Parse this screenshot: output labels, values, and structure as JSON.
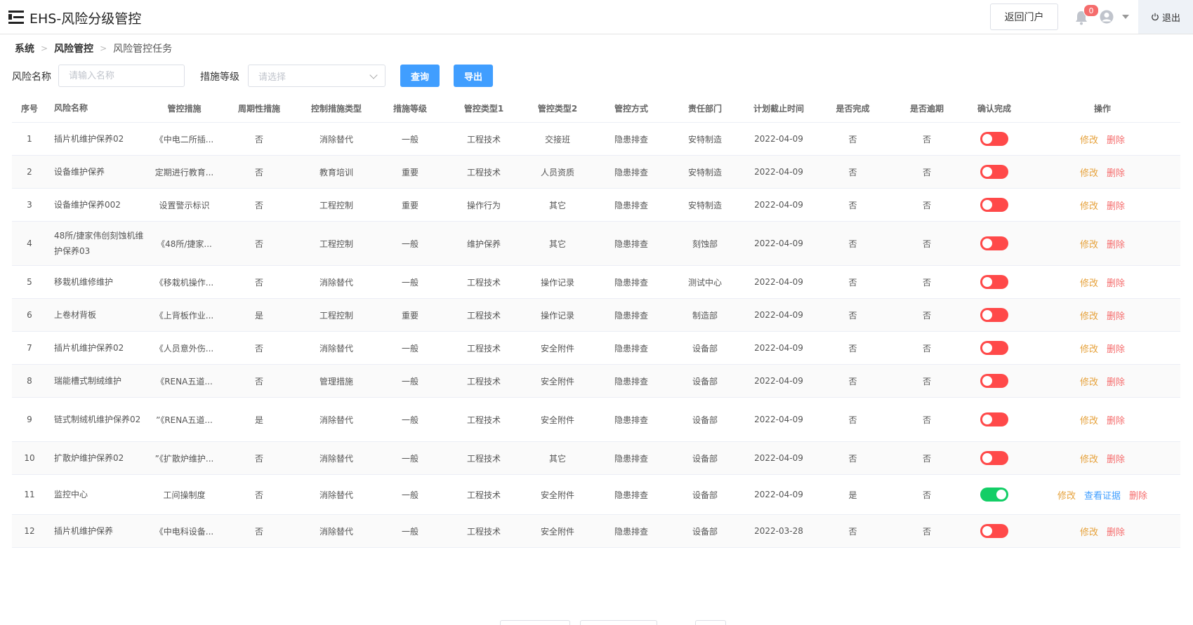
{
  "header": {
    "title": "EHS-风险分级管控",
    "portal_button": "返回门户",
    "notification_count": "0",
    "logout_label": "退出"
  },
  "breadcrumb": [
    "系统",
    "风险管控",
    "风险管控任务"
  ],
  "filters": {
    "risk_name_label": "风险名称",
    "risk_name_placeholder": "请输入名称",
    "level_label": "措施等级",
    "level_placeholder": "请选择",
    "query_button": "查询",
    "export_button": "导出"
  },
  "table": {
    "columns": [
      "序号",
      "风险名称",
      "管控措施",
      "周期性措施",
      "控制措施类型",
      "措施等级",
      "管控类型1",
      "管控类型2",
      "管控方式",
      "责任部门",
      "计划截止时间",
      "是否完成",
      "是否逾期",
      "确认完成",
      "操作"
    ],
    "actions": {
      "edit": "修改",
      "view": "查看证据",
      "delete": "删除"
    },
    "rows": [
      {
        "no": "1",
        "name": "插片机维护保养02",
        "measure": "《中电二所插...",
        "periodic": "否",
        "ctype": "消除替代",
        "level": "一般",
        "t1": "工程技术",
        "t2": "交接班",
        "method": "隐患排查",
        "dept": "安特制造",
        "deadline": "2022-04-09",
        "done": "否",
        "overdue": "否",
        "confirmed": false
      },
      {
        "no": "2",
        "name": "设备维护保养",
        "measure": "定期进行教育...",
        "periodic": "否",
        "ctype": "教育培训",
        "level": "重要",
        "t1": "工程技术",
        "t2": "人员资质",
        "method": "隐患排查",
        "dept": "安特制造",
        "deadline": "2022-04-09",
        "done": "否",
        "overdue": "否",
        "confirmed": false
      },
      {
        "no": "3",
        "name": "设备维护保养002",
        "measure": "设置警示标识",
        "periodic": "否",
        "ctype": "工程控制",
        "level": "重要",
        "t1": "操作行为",
        "t2": "其它",
        "method": "隐患排查",
        "dept": "安特制造",
        "deadline": "2022-04-09",
        "done": "否",
        "overdue": "否",
        "confirmed": false
      },
      {
        "no": "4",
        "name": "48所/捷家伟创刻蚀机维护保养03",
        "measure": "《48所/捷家...",
        "periodic": "否",
        "ctype": "工程控制",
        "level": "一般",
        "t1": "维护保养",
        "t2": "其它",
        "method": "隐患排查",
        "dept": "刻蚀部",
        "deadline": "2022-04-09",
        "done": "否",
        "overdue": "否",
        "confirmed": false
      },
      {
        "no": "5",
        "name": "移栽机维修维护",
        "measure": "《移栽机操作...",
        "periodic": "否",
        "ctype": "消除替代",
        "level": "一般",
        "t1": "工程技术",
        "t2": "操作记录",
        "method": "隐患排查",
        "dept": "测试中心",
        "deadline": "2022-04-09",
        "done": "否",
        "overdue": "否",
        "confirmed": false
      },
      {
        "no": "6",
        "name": "上卷材背板",
        "measure": "《上背板作业...",
        "periodic": "是",
        "ctype": "工程控制",
        "level": "重要",
        "t1": "工程技术",
        "t2": "操作记录",
        "method": "隐患排查",
        "dept": "制造部",
        "deadline": "2022-04-09",
        "done": "否",
        "overdue": "否",
        "confirmed": false
      },
      {
        "no": "7",
        "name": "插片机维护保养02",
        "measure": "《人员意外伤...",
        "periodic": "否",
        "ctype": "消除替代",
        "level": "一般",
        "t1": "工程技术",
        "t2": "安全附件",
        "method": "隐患排查",
        "dept": "设备部",
        "deadline": "2022-04-09",
        "done": "否",
        "overdue": "否",
        "confirmed": false
      },
      {
        "no": "8",
        "name": "瑞能槽式制绒维护",
        "measure": "《RENA五道...",
        "periodic": "否",
        "ctype": "管理措施",
        "level": "一般",
        "t1": "工程技术",
        "t2": "安全附件",
        "method": "隐患排查",
        "dept": "设备部",
        "deadline": "2022-04-09",
        "done": "否",
        "overdue": "否",
        "confirmed": false
      },
      {
        "no": "9",
        "name": "链式制绒机维护保养02",
        "measure": "”《RENA五道...",
        "periodic": "是",
        "ctype": "消除替代",
        "level": "一般",
        "t1": "工程技术",
        "t2": "安全附件",
        "method": "隐患排查",
        "dept": "设备部",
        "deadline": "2022-04-09",
        "done": "否",
        "overdue": "否",
        "confirmed": false
      },
      {
        "no": "10",
        "name": "扩散炉维护保养02",
        "measure": "”《扩散炉维护...",
        "periodic": "否",
        "ctype": "消除替代",
        "level": "一般",
        "t1": "工程技术",
        "t2": "其它",
        "method": "隐患排查",
        "dept": "设备部",
        "deadline": "2022-04-09",
        "done": "否",
        "overdue": "否",
        "confirmed": false
      },
      {
        "no": "11",
        "name": "监控中心",
        "measure": "工间操制度",
        "periodic": "否",
        "ctype": "消除替代",
        "level": "一般",
        "t1": "工程技术",
        "t2": "安全附件",
        "method": "隐患排查",
        "dept": "设备部",
        "deadline": "2022-04-09",
        "done": "是",
        "overdue": "否",
        "confirmed": true
      },
      {
        "no": "12",
        "name": "插片机维护保养",
        "measure": "《中电科设备...",
        "periodic": "否",
        "ctype": "消除替代",
        "level": "一般",
        "t1": "工程技术",
        "t2": "安全附件",
        "method": "隐患排查",
        "dept": "设备部",
        "deadline": "2022-03-28",
        "done": "否",
        "overdue": "否",
        "confirmed": false
      }
    ]
  }
}
